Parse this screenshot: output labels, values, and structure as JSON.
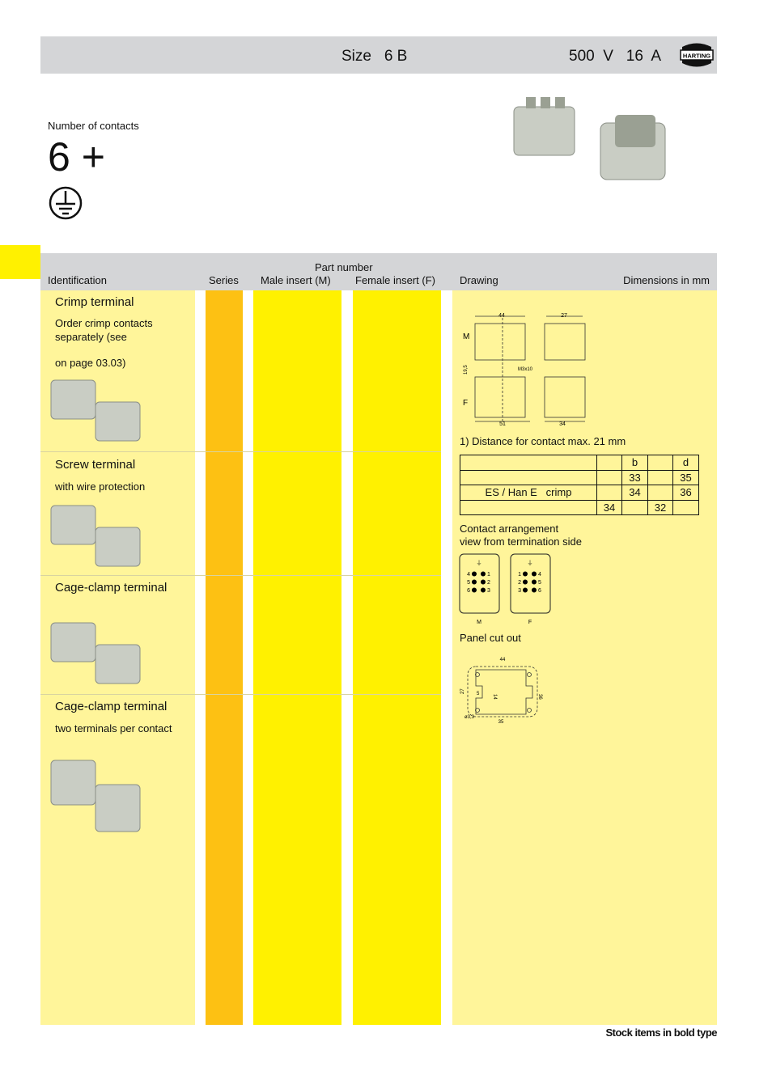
{
  "header": {
    "size_label": "Size",
    "size_value": "6 B",
    "voltage": "500  V",
    "current": "16  A",
    "logo_text": "HARTING"
  },
  "contacts": {
    "label": "Number of contacts",
    "value": "6 +",
    "earth_symbol": "earth-icon"
  },
  "table_header": {
    "part_number": "Part number",
    "identification": "Identification",
    "series": "Series",
    "male": "Male insert (M)",
    "female": "Female insert (F)",
    "drawing": "Drawing",
    "dimensions": "Dimensions in mm"
  },
  "rows": [
    {
      "title": "Crimp terminal",
      "sub": [
        "Order crimp contacts",
        "separately (see",
        "",
        "on page 03.03)"
      ]
    },
    {
      "title": "Screw terminal",
      "sub": [
        "with wire protection"
      ]
    },
    {
      "title": "Cage-clamp terminal",
      "sub": []
    },
    {
      "title": "Cage-clamp terminal",
      "sub": [
        "two terminals per contact"
      ]
    }
  ],
  "drawing": {
    "labels": {
      "m": "M",
      "f": "F",
      "w44": "44",
      "w27": "27",
      "w51": "51",
      "w34": "34",
      "h195": "19,5",
      "screw": "M3x10"
    },
    "footnote": "1) Distance for contact max. 21 mm",
    "dim_table": [
      [
        "",
        "",
        "b",
        "",
        "d"
      ],
      [
        "",
        "",
        "33",
        "",
        "35"
      ],
      [
        "ES / Han E   crimp",
        "",
        "34",
        "",
        "36"
      ],
      [
        "",
        "34",
        "",
        "32",
        ""
      ]
    ],
    "contact_title": "Contact arrangement",
    "contact_sub": "view from termination side",
    "male_label": "M",
    "female_label": "F",
    "male_pins": [
      "4",
      "1",
      "5",
      "2",
      "6",
      "3"
    ],
    "female_pins": [
      "1",
      "4",
      "2",
      "5",
      "3",
      "6"
    ],
    "panel_title": "Panel cut out",
    "panel_dims": {
      "w44": "44",
      "w35": "35",
      "h27": "27",
      "h36": "36",
      "h14": "14",
      "d5": "5",
      "hole": "ø3,3"
    }
  },
  "footer": {
    "stock_note": "Stock items in bold type"
  },
  "colors": {
    "header_gray": "#d4d5d7",
    "light_yellow": "#fff59a",
    "series_orange": "#fdc113",
    "part_yellow": "#fff100"
  }
}
